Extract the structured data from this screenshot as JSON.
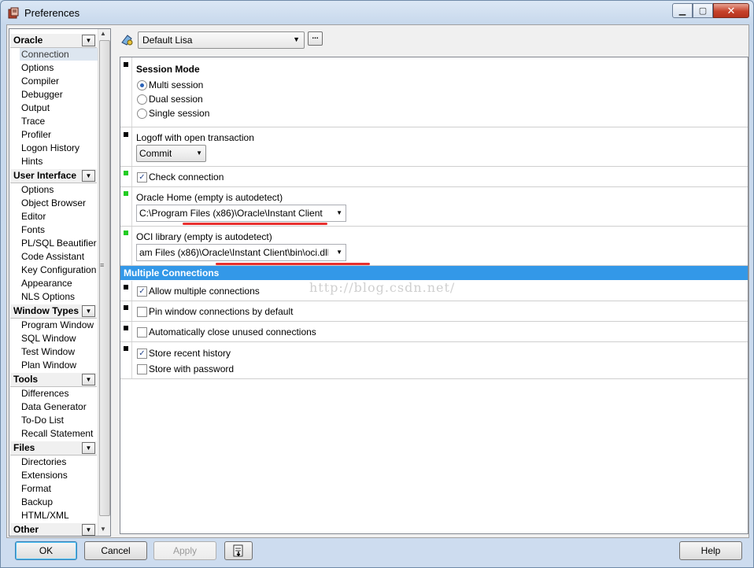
{
  "window": {
    "title": "Preferences"
  },
  "sidebar": {
    "categories": [
      {
        "label": "Oracle",
        "items": [
          "Connection",
          "Options",
          "Compiler",
          "Debugger",
          "Output",
          "Trace",
          "Profiler",
          "Logon History",
          "Hints"
        ]
      },
      {
        "label": "User Interface",
        "items": [
          "Options",
          "Object Browser",
          "Editor",
          "Fonts",
          "PL/SQL Beautifier",
          "Code Assistant",
          "Key Configuration",
          "Appearance",
          "NLS Options"
        ]
      },
      {
        "label": "Window Types",
        "items": [
          "Program Window",
          "SQL Window",
          "Test Window",
          "Plan Window"
        ]
      },
      {
        "label": "Tools",
        "items": [
          "Differences",
          "Data Generator",
          "To-Do List",
          "Recall Statement"
        ]
      },
      {
        "label": "Files",
        "items": [
          "Directories",
          "Extensions",
          "Format",
          "Backup",
          "HTML/XML"
        ]
      },
      {
        "label": "Other",
        "items": []
      }
    ],
    "selected": "Connection"
  },
  "profile": {
    "value": "Default Lisa",
    "more_label": "..."
  },
  "session": {
    "title": "Session Mode",
    "options": [
      "Multi session",
      "Dual session",
      "Single session"
    ],
    "selected": "Multi session"
  },
  "logoff": {
    "label": "Logoff with open transaction",
    "value": "Commit"
  },
  "check_connection": {
    "label": "Check connection",
    "checked": true
  },
  "oracle_home": {
    "label": "Oracle Home (empty is autodetect)",
    "value": "C:\\Program Files (x86)\\Oracle\\Instant Client"
  },
  "oci_library": {
    "label": "OCI library (empty is autodetect)",
    "value": "am Files (x86)\\Oracle\\Instant Client\\bin\\oci.dll"
  },
  "multiple_connections": {
    "header": "Multiple Connections",
    "allow": {
      "label": "Allow multiple connections",
      "checked": true
    },
    "pin": {
      "label": "Pin window connections by default",
      "checked": false
    },
    "auto_close": {
      "label": "Automatically close unused connections",
      "checked": false
    },
    "store_history": {
      "label": "Store recent history",
      "checked": true
    },
    "store_password": {
      "label": "Store with password",
      "checked": false
    }
  },
  "watermark": "http://blog.csdn.net/",
  "buttons": {
    "ok": "OK",
    "cancel": "Cancel",
    "apply": "Apply",
    "help": "Help"
  },
  "colors": {
    "selection_header": "#3398e8",
    "marker_green": "#22cc22",
    "annotation_red": "#e8302f"
  }
}
